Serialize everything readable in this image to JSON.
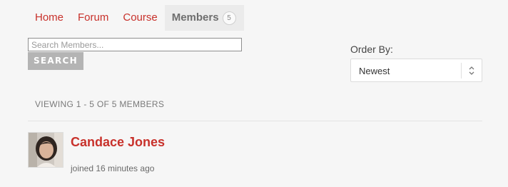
{
  "nav": {
    "tabs": [
      {
        "label": "Home"
      },
      {
        "label": "Forum"
      },
      {
        "label": "Course"
      },
      {
        "label": "Members",
        "count": "5"
      }
    ]
  },
  "search": {
    "placeholder": "Search Members...",
    "value": "",
    "button_label": "SEARCH"
  },
  "order": {
    "label": "Order By:",
    "selected": "Newest"
  },
  "listing": {
    "viewing_text": "VIEWING 1 - 5 OF 5 MEMBERS"
  },
  "members": [
    {
      "name": "Candace Jones",
      "meta": "joined 16 minutes ago",
      "avatar_icon": "avatar-photo"
    }
  ],
  "colors": {
    "link": "#c8312b",
    "background": "#f6f6f6",
    "button": "#b4b4b4"
  }
}
